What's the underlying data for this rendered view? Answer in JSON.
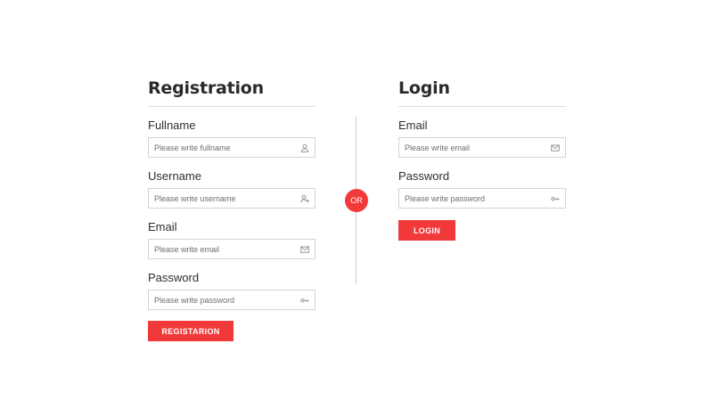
{
  "registration": {
    "title": "Registration",
    "fields": [
      {
        "label": "Fullname",
        "placeholder": "Please write fullname",
        "icon": "user-icon"
      },
      {
        "label": "Username",
        "placeholder": "Please write username",
        "icon": "user-plus-icon"
      },
      {
        "label": "Email",
        "placeholder": "Please write email",
        "icon": "mail-icon"
      },
      {
        "label": "Password",
        "placeholder": "Please write password",
        "icon": "key-icon"
      }
    ],
    "button_label": "REGISTARION"
  },
  "separator": {
    "label": "OR"
  },
  "login": {
    "title": "Login",
    "fields": [
      {
        "label": "Email",
        "placeholder": "Please write email",
        "icon": "mail-icon"
      },
      {
        "label": "Password",
        "placeholder": "Please write password",
        "icon": "key-icon"
      }
    ],
    "button_label": "LOGIN"
  },
  "colors": {
    "accent": "#f2393a",
    "text": "#2b2b2b",
    "border": "#d4d4d4",
    "rule": "#dedede"
  }
}
